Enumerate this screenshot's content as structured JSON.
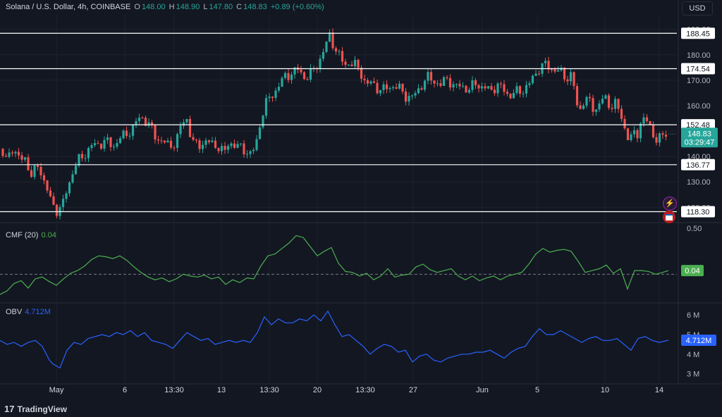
{
  "header": {
    "symbol": "Solana / U.S. Dollar, 4h, COINBASE",
    "o_label": "O",
    "o_value": "148.00",
    "h_label": "H",
    "h_value": "148.90",
    "l_label": "L",
    "l_value": "147.80",
    "c_label": "C",
    "c_value": "148.83",
    "change": "+0.89 (+0.60%)"
  },
  "currency": "USD",
  "cmf_label": "CMF (20)",
  "cmf_value": "0.04",
  "obv_label": "OBV",
  "obv_value": "4.712M",
  "logo_text": "TradingView",
  "icons": [
    "bolt-icon",
    "us-flag-icon"
  ],
  "colors": {
    "up": "#26a69a",
    "down": "#ef5350",
    "cmf": "#4caf50",
    "obv": "#2962ff",
    "bg": "#131722",
    "level": "#ffffff"
  },
  "chart_data": [
    {
      "type": "candlestick",
      "title": "Solana / U.S. Dollar, 4h, COINBASE",
      "ylim": [
        114,
        196
      ],
      "y_ticks": [
        "190.00",
        "180.00",
        "170.00",
        "160.00",
        "150.00",
        "140.00",
        "130.00",
        "120.00"
      ],
      "levels": [
        188.45,
        174.54,
        152.48,
        136.77,
        118.3
      ],
      "last_price": 148.83,
      "countdown": "03:29:47",
      "x_tick_labels": [
        "May",
        "6",
        "13:30",
        "13",
        "13:30",
        "20",
        "13:30",
        "27",
        "Jun",
        "5",
        "10",
        "14"
      ],
      "grid": true,
      "close_path": [
        [
          0,
          143
        ],
        [
          8,
          138
        ],
        [
          18,
          144
        ],
        [
          28,
          138
        ],
        [
          35,
          140
        ],
        [
          45,
          132
        ],
        [
          55,
          137
        ],
        [
          65,
          128
        ],
        [
          73,
          122
        ],
        [
          80,
          119
        ],
        [
          88,
          120
        ],
        [
          95,
          127
        ],
        [
          103,
          134
        ],
        [
          110,
          138
        ],
        [
          120,
          141
        ],
        [
          130,
          144
        ],
        [
          140,
          145
        ],
        [
          150,
          146
        ],
        [
          160,
          144
        ],
        [
          170,
          147
        ],
        [
          180,
          149
        ],
        [
          190,
          152
        ],
        [
          200,
          156
        ],
        [
          210,
          153
        ],
        [
          220,
          148
        ],
        [
          230,
          146
        ],
        [
          240,
          144
        ],
        [
          250,
          146
        ],
        [
          258,
          153
        ],
        [
          265,
          155
        ],
        [
          272,
          146
        ],
        [
          280,
          144
        ],
        [
          290,
          146
        ],
        [
          300,
          145
        ],
        [
          310,
          144
        ],
        [
          318,
          141
        ],
        [
          325,
          146
        ],
        [
          335,
          144
        ],
        [
          345,
          143
        ],
        [
          355,
          141
        ],
        [
          362,
          143
        ],
        [
          368,
          152
        ],
        [
          375,
          160
        ],
        [
          383,
          163
        ],
        [
          393,
          167
        ],
        [
          403,
          171
        ],
        [
          413,
          173
        ],
        [
          423,
          174
        ],
        [
          433,
          171
        ],
        [
          443,
          173
        ],
        [
          453,
          178
        ],
        [
          460,
          182
        ],
        [
          468,
          188
        ],
        [
          473,
          184
        ],
        [
          480,
          180
        ],
        [
          488,
          176
        ],
        [
          495,
          177
        ],
        [
          503,
          176
        ],
        [
          512,
          173
        ],
        [
          520,
          168
        ],
        [
          527,
          169
        ],
        [
          535,
          167
        ],
        [
          545,
          166
        ],
        [
          555,
          168
        ],
        [
          565,
          167
        ],
        [
          575,
          164
        ],
        [
          585,
          163
        ],
        [
          595,
          167
        ],
        [
          605,
          171
        ],
        [
          615,
          170
        ],
        [
          625,
          168
        ],
        [
          635,
          171
        ],
        [
          645,
          167
        ],
        [
          655,
          168
        ],
        [
          665,
          166
        ],
        [
          675,
          169
        ],
        [
          685,
          167
        ],
        [
          695,
          166
        ],
        [
          705,
          168
        ],
        [
          715,
          166
        ],
        [
          723,
          164
        ],
        [
          730,
          165
        ],
        [
          740,
          166
        ],
        [
          750,
          168
        ],
        [
          758,
          172
        ],
        [
          765,
          175
        ],
        [
          773,
          176
        ],
        [
          780,
          175
        ],
        [
          788,
          174
        ],
        [
          795,
          173
        ],
        [
          803,
          171
        ],
        [
          810,
          172
        ],
        [
          815,
          166
        ],
        [
          820,
          157
        ],
        [
          827,
          162
        ],
        [
          835,
          162
        ],
        [
          843,
          158
        ],
        [
          850,
          161
        ],
        [
          857,
          163
        ],
        [
          865,
          160
        ],
        [
          873,
          161
        ],
        [
          880,
          156
        ],
        [
          888,
          150
        ],
        [
          893,
          146
        ],
        [
          898,
          149
        ],
        [
          903,
          148
        ],
        [
          910,
          155
        ],
        [
          915,
          155
        ],
        [
          920,
          152
        ],
        [
          925,
          150
        ],
        [
          930,
          147
        ],
        [
          935,
          147
        ],
        [
          940,
          148
        ],
        [
          948,
          148.83
        ]
      ]
    },
    {
      "type": "line",
      "name": "CMF (20)",
      "ylim": [
        -0.25,
        0.5
      ],
      "y_ticks": [
        "0.50"
      ],
      "zero_line": 0,
      "last_value": 0.04,
      "values_path": [
        [
          0,
          -0.22
        ],
        [
          10,
          -0.18
        ],
        [
          20,
          -0.1
        ],
        [
          30,
          -0.07
        ],
        [
          40,
          -0.15
        ],
        [
          50,
          -0.05
        ],
        [
          60,
          -0.03
        ],
        [
          70,
          -0.08
        ],
        [
          80,
          -0.12
        ],
        [
          90,
          -0.05
        ],
        [
          100,
          0.01
        ],
        [
          110,
          0.04
        ],
        [
          120,
          0.09
        ],
        [
          130,
          0.16
        ],
        [
          140,
          0.2
        ],
        [
          150,
          0.19
        ],
        [
          160,
          0.17
        ],
        [
          170,
          0.2
        ],
        [
          180,
          0.15
        ],
        [
          190,
          0.08
        ],
        [
          200,
          0.02
        ],
        [
          210,
          -0.03
        ],
        [
          220,
          -0.06
        ],
        [
          230,
          -0.04
        ],
        [
          240,
          -0.08
        ],
        [
          250,
          -0.05
        ],
        [
          260,
          0.0
        ],
        [
          270,
          -0.02
        ],
        [
          280,
          -0.03
        ],
        [
          290,
          -0.01
        ],
        [
          300,
          -0.05
        ],
        [
          310,
          -0.03
        ],
        [
          320,
          -0.11
        ],
        [
          330,
          -0.06
        ],
        [
          340,
          -0.09
        ],
        [
          350,
          -0.04
        ],
        [
          360,
          -0.05
        ],
        [
          370,
          0.09
        ],
        [
          380,
          0.2
        ],
        [
          390,
          0.22
        ],
        [
          400,
          0.28
        ],
        [
          410,
          0.34
        ],
        [
          420,
          0.42
        ],
        [
          430,
          0.4
        ],
        [
          440,
          0.3
        ],
        [
          450,
          0.2
        ],
        [
          460,
          0.25
        ],
        [
          470,
          0.29
        ],
        [
          480,
          0.12
        ],
        [
          490,
          0.03
        ],
        [
          500,
          0.02
        ],
        [
          510,
          -0.02
        ],
        [
          520,
          0.01
        ],
        [
          530,
          -0.06
        ],
        [
          540,
          -0.02
        ],
        [
          550,
          0.06
        ],
        [
          560,
          -0.03
        ],
        [
          570,
          -0.01
        ],
        [
          580,
          0.0
        ],
        [
          590,
          0.08
        ],
        [
          600,
          0.11
        ],
        [
          610,
          0.05
        ],
        [
          620,
          0.02
        ],
        [
          630,
          0.04
        ],
        [
          640,
          0.06
        ],
        [
          650,
          -0.02
        ],
        [
          660,
          -0.06
        ],
        [
          670,
          -0.02
        ],
        [
          680,
          -0.07
        ],
        [
          690,
          -0.04
        ],
        [
          700,
          -0.02
        ],
        [
          710,
          -0.06
        ],
        [
          720,
          -0.02
        ],
        [
          730,
          0.0
        ],
        [
          740,
          0.02
        ],
        [
          750,
          0.11
        ],
        [
          760,
          0.22
        ],
        [
          770,
          0.28
        ],
        [
          780,
          0.24
        ],
        [
          790,
          0.26
        ],
        [
          800,
          0.27
        ],
        [
          810,
          0.25
        ],
        [
          820,
          0.14
        ],
        [
          830,
          0.02
        ],
        [
          840,
          0.04
        ],
        [
          850,
          0.06
        ],
        [
          860,
          0.1
        ],
        [
          870,
          0.01
        ],
        [
          880,
          0.06
        ],
        [
          890,
          -0.16
        ],
        [
          900,
          0.04
        ],
        [
          910,
          0.04
        ],
        [
          920,
          0.03
        ],
        [
          930,
          0.0
        ],
        [
          940,
          0.02
        ],
        [
          948,
          0.04
        ]
      ]
    },
    {
      "type": "line",
      "name": "OBV",
      "ylim": [
        2.7,
        6.4
      ],
      "y_ticks": [
        "6 M",
        "5 M",
        "4 M",
        "3 M"
      ],
      "last_value": 4.712,
      "values_path": [
        [
          0,
          4.7
        ],
        [
          10,
          4.5
        ],
        [
          20,
          4.6
        ],
        [
          30,
          4.4
        ],
        [
          40,
          4.6
        ],
        [
          50,
          4.7
        ],
        [
          60,
          4.4
        ],
        [
          70,
          3.7
        ],
        [
          75,
          3.5
        ],
        [
          85,
          3.3
        ],
        [
          95,
          4.2
        ],
        [
          105,
          4.6
        ],
        [
          115,
          4.5
        ],
        [
          125,
          4.8
        ],
        [
          135,
          4.9
        ],
        [
          145,
          5.0
        ],
        [
          155,
          4.9
        ],
        [
          165,
          5.1
        ],
        [
          175,
          5.0
        ],
        [
          185,
          5.2
        ],
        [
          195,
          4.9
        ],
        [
          205,
          5.1
        ],
        [
          215,
          4.7
        ],
        [
          225,
          4.6
        ],
        [
          235,
          4.5
        ],
        [
          245,
          4.3
        ],
        [
          255,
          4.7
        ],
        [
          265,
          5.1
        ],
        [
          275,
          4.9
        ],
        [
          285,
          4.7
        ],
        [
          295,
          4.8
        ],
        [
          305,
          4.5
        ],
        [
          315,
          4.6
        ],
        [
          325,
          4.7
        ],
        [
          335,
          4.6
        ],
        [
          345,
          4.7
        ],
        [
          355,
          4.6
        ],
        [
          365,
          5.1
        ],
        [
          375,
          5.9
        ],
        [
          385,
          5.5
        ],
        [
          395,
          5.8
        ],
        [
          405,
          5.6
        ],
        [
          415,
          5.6
        ],
        [
          425,
          5.8
        ],
        [
          435,
          5.7
        ],
        [
          445,
          6.0
        ],
        [
          455,
          5.7
        ],
        [
          465,
          6.2
        ],
        [
          475,
          5.5
        ],
        [
          485,
          4.9
        ],
        [
          495,
          5.0
        ],
        [
          505,
          4.7
        ],
        [
          515,
          4.4
        ],
        [
          525,
          4.0
        ],
        [
          535,
          4.3
        ],
        [
          545,
          4.5
        ],
        [
          555,
          4.4
        ],
        [
          565,
          4.1
        ],
        [
          575,
          4.2
        ],
        [
          585,
          3.6
        ],
        [
          595,
          3.9
        ],
        [
          605,
          4.0
        ],
        [
          615,
          3.7
        ],
        [
          625,
          3.6
        ],
        [
          635,
          3.8
        ],
        [
          645,
          3.9
        ],
        [
          655,
          4.0
        ],
        [
          665,
          4.0
        ],
        [
          675,
          4.1
        ],
        [
          685,
          4.1
        ],
        [
          695,
          4.2
        ],
        [
          705,
          4.0
        ],
        [
          715,
          3.8
        ],
        [
          725,
          4.1
        ],
        [
          735,
          4.3
        ],
        [
          745,
          4.4
        ],
        [
          755,
          4.9
        ],
        [
          765,
          5.3
        ],
        [
          775,
          5.0
        ],
        [
          785,
          5.0
        ],
        [
          795,
          5.2
        ],
        [
          805,
          5.0
        ],
        [
          815,
          4.8
        ],
        [
          825,
          4.6
        ],
        [
          835,
          4.8
        ],
        [
          845,
          4.9
        ],
        [
          855,
          4.7
        ],
        [
          865,
          4.7
        ],
        [
          875,
          4.8
        ],
        [
          885,
          4.5
        ],
        [
          895,
          4.2
        ],
        [
          905,
          4.8
        ],
        [
          915,
          4.9
        ],
        [
          925,
          4.7
        ],
        [
          935,
          4.6
        ],
        [
          948,
          4.712
        ]
      ]
    }
  ]
}
